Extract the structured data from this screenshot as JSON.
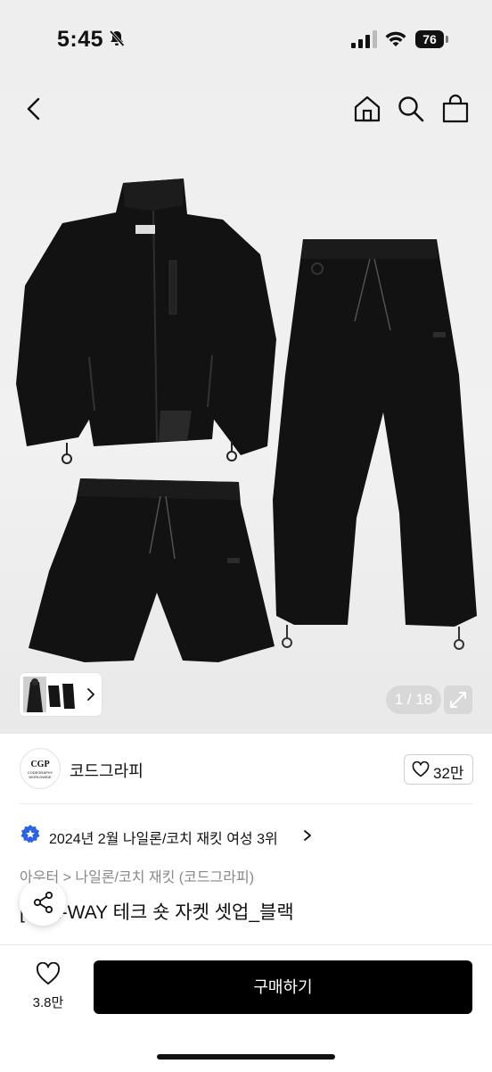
{
  "status_bar": {
    "time": "5:45",
    "battery": "76"
  },
  "gallery": {
    "counter": "1 / 18"
  },
  "brand": {
    "logo_text": "CGP",
    "logo_subtext": "CODEGRAPHY WORLDWIDE",
    "name": "코드그라피",
    "like_count": "32만"
  },
  "ranking": {
    "text": "2024년 2월 나일론/코치 재킷 여성 3위"
  },
  "category": {
    "text": "아우터 > 나일론/코치 재킷 (코드그라피)"
  },
  "product": {
    "title": "[...] 2-WAY 테크 숏 자켓 셋업_블랙"
  },
  "bottom": {
    "wish_count": "3.8만",
    "buy_label": "구매하기"
  },
  "colors": {
    "accent": "#000000",
    "badge": "#2a62e8"
  },
  "icons": [
    "bell-off-icon",
    "signal-icon",
    "wifi-icon",
    "back-icon",
    "home-icon",
    "search-icon",
    "bag-icon",
    "chevron-right-icon",
    "expand-icon",
    "heart-icon",
    "badge-icon",
    "share-icon"
  ]
}
